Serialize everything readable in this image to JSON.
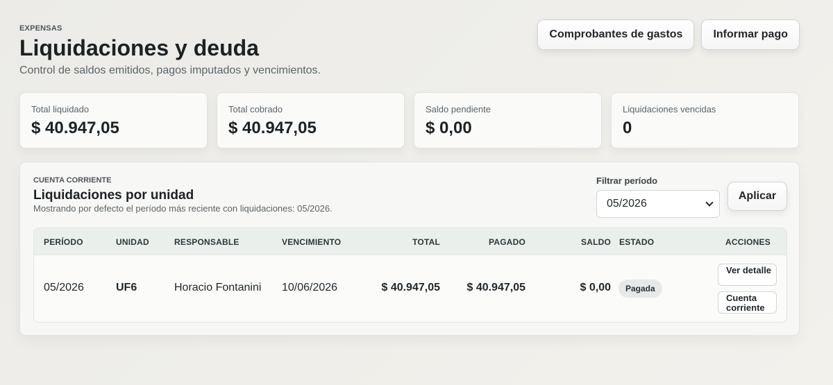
{
  "header": {
    "eyebrow": "EXPENSAS",
    "title": "Liquidaciones y deuda",
    "subtitle": "Control de saldos emitidos, pagos imputados y vencimientos.",
    "buttons": {
      "receipts": "Comprobantes de gastos",
      "report_payment": "Informar pago"
    }
  },
  "stats": [
    {
      "label": "Total liquidado",
      "value": "$ 40.947,05"
    },
    {
      "label": "Total cobrado",
      "value": "$ 40.947,05"
    },
    {
      "label": "Saldo pendiente",
      "value": "$ 0,00"
    },
    {
      "label": "Liquidaciones vencidas",
      "value": "0"
    }
  ],
  "panel": {
    "eyebrow": "CUENTA CORRIENTE",
    "title": "Liquidaciones por unidad",
    "description": "Mostrando por defecto el período más reciente con liquidaciones: 05/2026.",
    "filter": {
      "label": "Filtrar período",
      "selected": "05/2026",
      "apply_label": "Aplicar"
    },
    "table": {
      "columns": [
        "PERÍODO",
        "UNIDAD",
        "RESPONSABLE",
        "VENCIMIENTO",
        "TOTAL",
        "PAGADO",
        "SALDO",
        "ESTADO",
        "ACCIONES"
      ],
      "rows": [
        {
          "period": "05/2026",
          "unit": "UF6",
          "responsible": "Horacio Fontanini",
          "due": "10/06/2026",
          "total": "$ 40.947,05",
          "paid": "$ 40.947,05",
          "balance": "$ 0,00",
          "status": "Pagada",
          "actions": {
            "detail": "Ver detalle",
            "account": "Cuenta corriente"
          }
        }
      ]
    }
  }
}
